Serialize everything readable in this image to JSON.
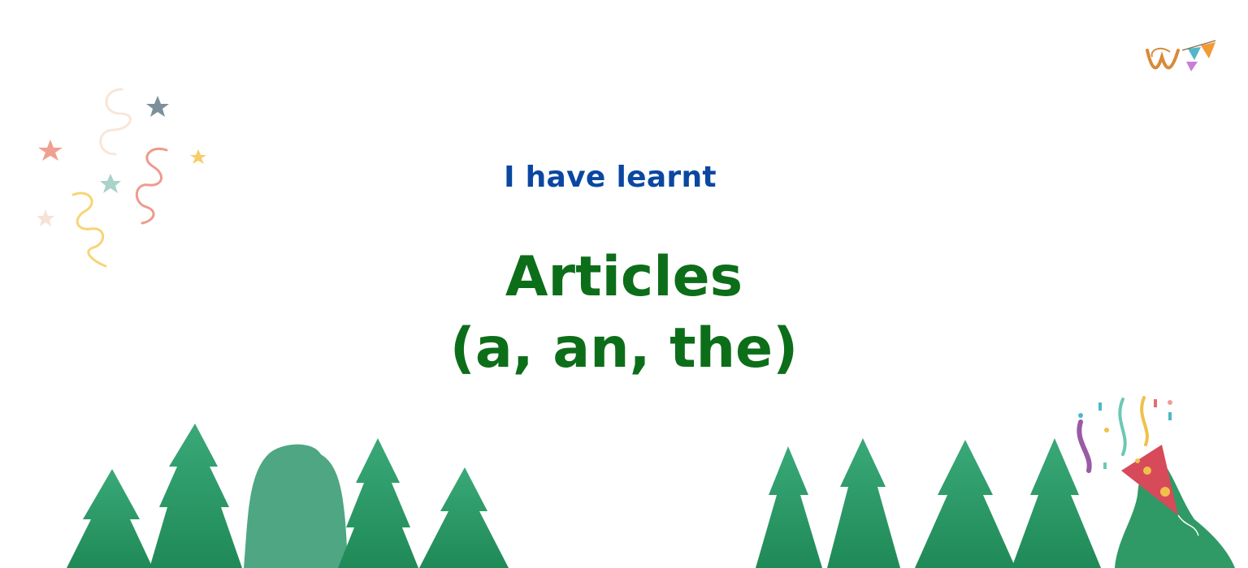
{
  "heading": {
    "subtitle": "I have learnt",
    "title_line1": "Articles",
    "title_line2": "(a, an, the)"
  },
  "colors": {
    "subtitle": "#0b47a1",
    "title": "#0d6e1a",
    "trees": "#2e9a6a"
  },
  "icons": [
    "logo-icon",
    "confetti-icon",
    "party-popper-icon",
    "tree-icon"
  ]
}
